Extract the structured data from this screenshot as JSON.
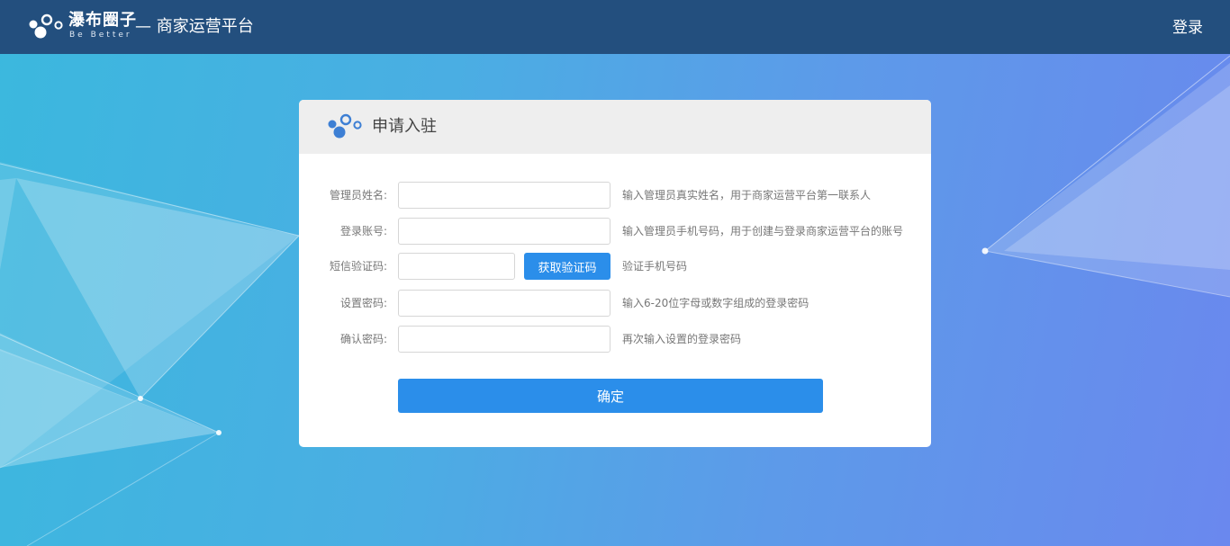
{
  "header": {
    "brand_name": "瀑布圈子",
    "brand_tagline": "Be Better",
    "platform_title": "— 商家运营平台",
    "login_label": "登录"
  },
  "card": {
    "title": "申请入驻",
    "fields": [
      {
        "label": "管理员姓名:",
        "value": "",
        "placeholder": "",
        "hint": "输入管理员真实姓名，用于商家运营平台第一联系人"
      },
      {
        "label": "登录账号:",
        "value": "",
        "placeholder": "",
        "hint": "输入管理员手机号码，用于创建与登录商家运营平台的账号"
      },
      {
        "label": "短信验证码:",
        "value": "",
        "placeholder": "",
        "hint": "验证手机号码",
        "button_label": "获取验证码"
      },
      {
        "label": "设置密码:",
        "value": "",
        "placeholder": "",
        "hint": "输入6-20位字母或数字组成的登录密码"
      },
      {
        "label": "确认密码:",
        "value": "",
        "placeholder": "",
        "hint": "再次输入设置的登录密码"
      }
    ],
    "submit_label": "确定"
  },
  "colors": {
    "header_bg": "#234f7e",
    "accent": "#2b8eea",
    "card_head_bg": "#eeeeee",
    "logo_blue": "#3d7fd4"
  },
  "icons": {
    "header_logo": "bubbles-logo-icon",
    "card_logo": "bubbles-logo-icon"
  }
}
